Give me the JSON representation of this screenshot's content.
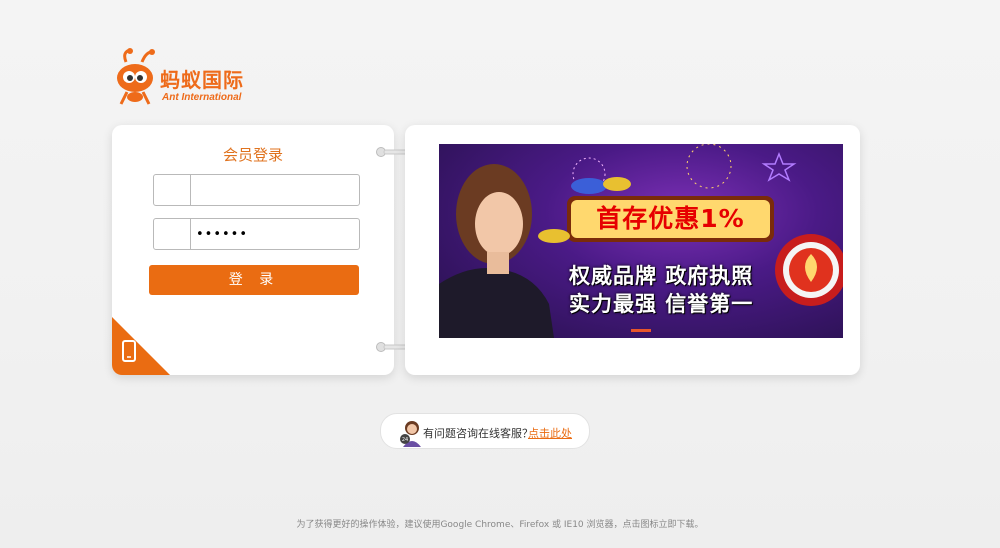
{
  "brand": {
    "name_cn": "蚂蚁国际",
    "name_en": "Ant International",
    "color": "#ee6b1a"
  },
  "login": {
    "title": "会员登录",
    "username_value": "",
    "password_value": "••••••",
    "submit_label": "登 录",
    "user_icon": "user-icon",
    "lock_icon": "lock-icon",
    "mobile_icon": "mobile-phone-icon"
  },
  "banner": {
    "headline": "首存优惠1%",
    "slogan_line1": "权威品牌  政府执照",
    "slogan_line2": "实力最强  信誉第一",
    "accent": "#e8562a"
  },
  "help": {
    "text": "有问题咨询在线客服？",
    "link": "点击此处",
    "avatar_icon": "support-agent-icon",
    "badge": "24"
  },
  "footer": {
    "text": "为了获得更好的操作体验，建议使用Google Chrome、Firefox 或 IE10 浏览器，点击图标立即下载。"
  }
}
